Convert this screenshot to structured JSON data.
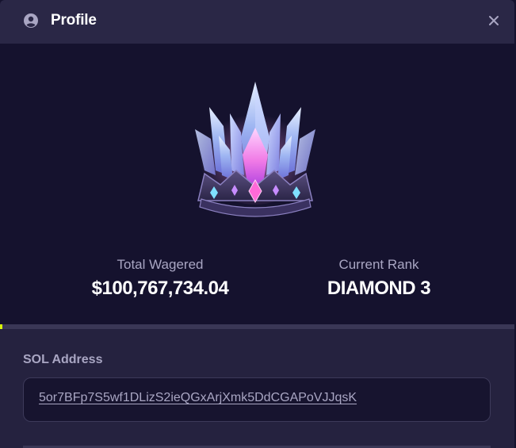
{
  "header": {
    "title": "Profile",
    "user_icon": "user-circle-icon",
    "close_icon": "close-icon"
  },
  "stats": {
    "total_wagered_label": "Total Wagered",
    "total_wagered_value": "$100,767,734.04",
    "current_rank_label": "Current Rank",
    "current_rank_value": "DIAMOND 3"
  },
  "rank_progress": {
    "fraction": 0.004,
    "fill_color": "#d6f20a"
  },
  "address": {
    "label": "SOL Address",
    "value": "5or7BFp7S5wf1DLizS2ieQGxArjXmk5DdCGAPoVJJqsK"
  },
  "colors": {
    "background": "#15122e",
    "header": "#2a2746",
    "panel": "#25223f",
    "muted_text": "#a9a6c3"
  },
  "images": {
    "rank_badge": "diamond-crown-icon"
  }
}
